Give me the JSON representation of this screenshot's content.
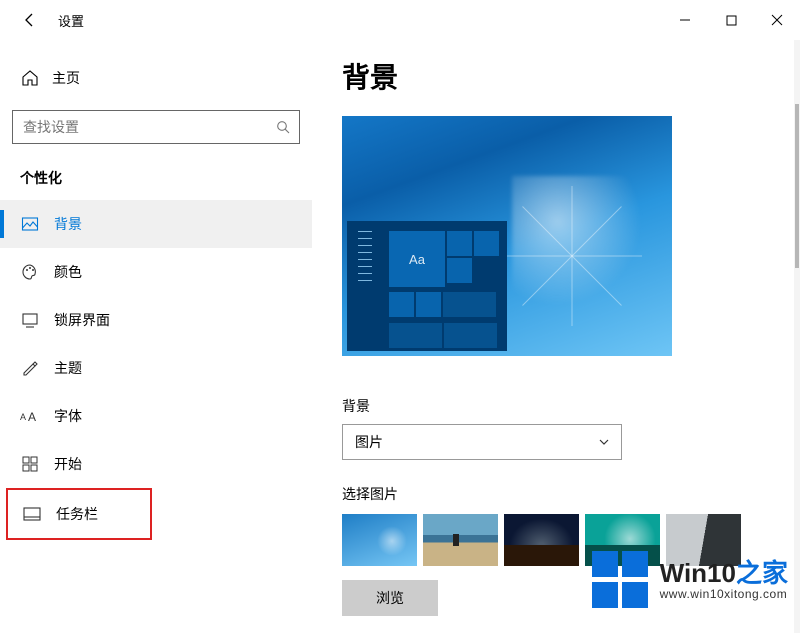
{
  "titlebar": {
    "title": "设置"
  },
  "sidebar": {
    "home": "主页",
    "search_placeholder": "查找设置",
    "section": "个性化",
    "items": [
      {
        "id": "background",
        "label": "背景",
        "selected": true
      },
      {
        "id": "colors",
        "label": "颜色"
      },
      {
        "id": "lockscreen",
        "label": "锁屏界面"
      },
      {
        "id": "themes",
        "label": "主题"
      },
      {
        "id": "fonts",
        "label": "字体"
      },
      {
        "id": "start",
        "label": "开始"
      },
      {
        "id": "taskbar",
        "label": "任务栏",
        "highlighted": true
      }
    ]
  },
  "main": {
    "title": "背景",
    "preview_tile_text": "Aa",
    "bg_label": "背景",
    "bg_select_value": "图片",
    "pick_label": "选择图片",
    "browse_label": "浏览"
  },
  "watermark": {
    "brand_prefix": "Win10",
    "brand_suffix": "之家",
    "url": "www.win10xitong.com"
  }
}
